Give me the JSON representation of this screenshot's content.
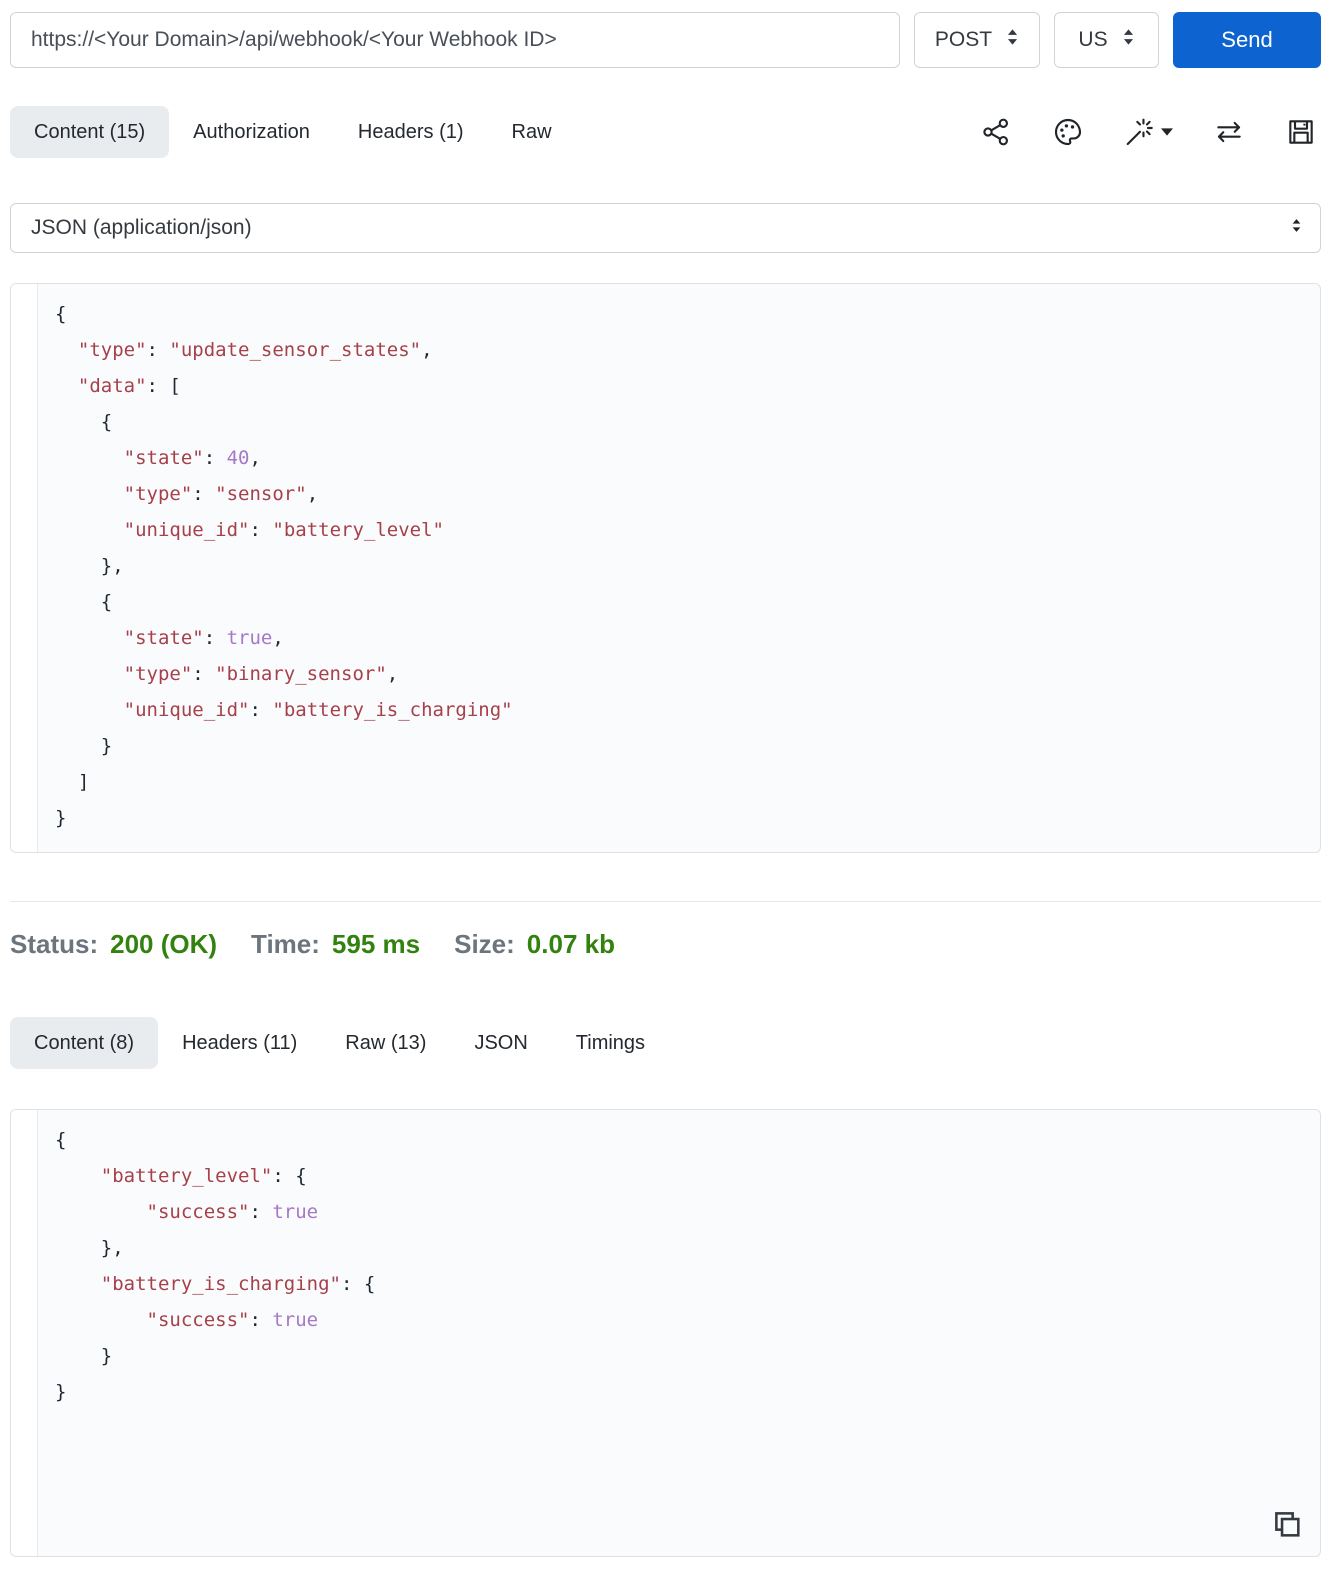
{
  "colors": {
    "accent-blue": "#0d64d1",
    "status-green": "#33820f",
    "string-red": "#a6404a",
    "value-purple": "#a578c8",
    "punct-dark": "#1f2733",
    "active-tab-bg": "#e9ecef"
  },
  "request_bar": {
    "url": "https://<Your Domain>/api/webhook/<Your Webhook ID>",
    "method": "POST",
    "region": "US",
    "send_label": "Send"
  },
  "request_tabs": {
    "items": [
      {
        "label": "Content (15)",
        "active": true
      },
      {
        "label": "Authorization",
        "active": false
      },
      {
        "label": "Headers (1)",
        "active": false
      },
      {
        "label": "Raw",
        "active": false
      }
    ]
  },
  "toolbar_icons": [
    {
      "name": "share-icon"
    },
    {
      "name": "palette-icon"
    },
    {
      "name": "magic-wand-icon",
      "has_dropdown": true
    },
    {
      "name": "swap-arrows-icon"
    },
    {
      "name": "save-icon"
    }
  ],
  "body_type": {
    "value": "JSON (application/json)"
  },
  "request_body": {
    "lines": [
      [
        [
          "p",
          "{"
        ]
      ],
      [
        [
          "p",
          "  "
        ],
        [
          "s",
          "\"type\""
        ],
        [
          "p",
          ": "
        ],
        [
          "s",
          "\"update_sensor_states\""
        ],
        [
          "p",
          ","
        ]
      ],
      [
        [
          "p",
          "  "
        ],
        [
          "s",
          "\"data\""
        ],
        [
          "p",
          ": ["
        ]
      ],
      [
        [
          "p",
          "    {"
        ]
      ],
      [
        [
          "p",
          "      "
        ],
        [
          "s",
          "\"state\""
        ],
        [
          "p",
          ": "
        ],
        [
          "n",
          "40"
        ],
        [
          "p",
          ","
        ]
      ],
      [
        [
          "p",
          "      "
        ],
        [
          "s",
          "\"type\""
        ],
        [
          "p",
          ": "
        ],
        [
          "s",
          "\"sensor\""
        ],
        [
          "p",
          ","
        ]
      ],
      [
        [
          "p",
          "      "
        ],
        [
          "s",
          "\"unique_id\""
        ],
        [
          "p",
          ": "
        ],
        [
          "s",
          "\"battery_level\""
        ]
      ],
      [
        [
          "p",
          "    },"
        ]
      ],
      [
        [
          "p",
          "    {"
        ]
      ],
      [
        [
          "p",
          "      "
        ],
        [
          "s",
          "\"state\""
        ],
        [
          "p",
          ": "
        ],
        [
          "n",
          "true"
        ],
        [
          "p",
          ","
        ]
      ],
      [
        [
          "p",
          "      "
        ],
        [
          "s",
          "\"type\""
        ],
        [
          "p",
          ": "
        ],
        [
          "s",
          "\"binary_sensor\""
        ],
        [
          "p",
          ","
        ]
      ],
      [
        [
          "p",
          "      "
        ],
        [
          "s",
          "\"unique_id\""
        ],
        [
          "p",
          ": "
        ],
        [
          "s",
          "\"battery_is_charging\""
        ]
      ],
      [
        [
          "p",
          "    }"
        ]
      ],
      [
        [
          "p",
          "  ]"
        ]
      ],
      [
        [
          "p",
          "}"
        ]
      ]
    ]
  },
  "status_bar": {
    "status_label": "Status:",
    "status_value": "200 (OK)",
    "time_label": "Time:",
    "time_value": "595 ms",
    "size_label": "Size:",
    "size_value": "0.07 kb"
  },
  "response_tabs": {
    "items": [
      {
        "label": "Content (8)",
        "active": true
      },
      {
        "label": "Headers (11)",
        "active": false
      },
      {
        "label": "Raw (13)",
        "active": false
      },
      {
        "label": "JSON",
        "active": false
      },
      {
        "label": "Timings",
        "active": false
      }
    ]
  },
  "response_body": {
    "lines": [
      [
        [
          "p",
          "{"
        ]
      ],
      [
        [
          "p",
          "    "
        ],
        [
          "s",
          "\"battery_level\""
        ],
        [
          "p",
          ": {"
        ]
      ],
      [
        [
          "p",
          "        "
        ],
        [
          "s",
          "\"success\""
        ],
        [
          "p",
          ": "
        ],
        [
          "n",
          "true"
        ]
      ],
      [
        [
          "p",
          "    },"
        ]
      ],
      [
        [
          "p",
          "    "
        ],
        [
          "s",
          "\"battery_is_charging\""
        ],
        [
          "p",
          ": {"
        ]
      ],
      [
        [
          "p",
          "        "
        ],
        [
          "s",
          "\"success\""
        ],
        [
          "p",
          ": "
        ],
        [
          "n",
          "true"
        ]
      ],
      [
        [
          "p",
          "    }"
        ]
      ],
      [
        [
          "p",
          "}"
        ]
      ]
    ]
  }
}
